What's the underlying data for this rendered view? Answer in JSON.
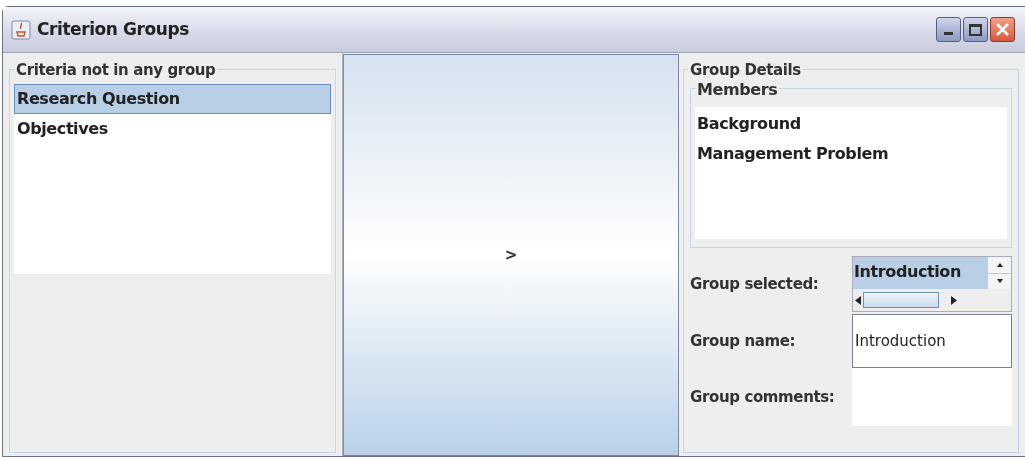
{
  "window": {
    "title": "Criterion Groups"
  },
  "criteria_panel": {
    "title": "Criteria not in any group",
    "items": [
      {
        "label": "Research Question",
        "selected": true
      },
      {
        "label": "Objectives",
        "selected": false
      }
    ]
  },
  "move_button": {
    "label": ">"
  },
  "group_details": {
    "title": "Group Details",
    "members": {
      "title": "Members",
      "items": [
        "Background",
        "Management Problem"
      ]
    },
    "group_selected": {
      "label": "Group selected:",
      "items": [
        {
          "label": "Introduction",
          "selected": true
        }
      ]
    },
    "group_name": {
      "label": "Group name:",
      "value": "Introduction"
    },
    "group_comments": {
      "label": "Group comments:"
    }
  }
}
